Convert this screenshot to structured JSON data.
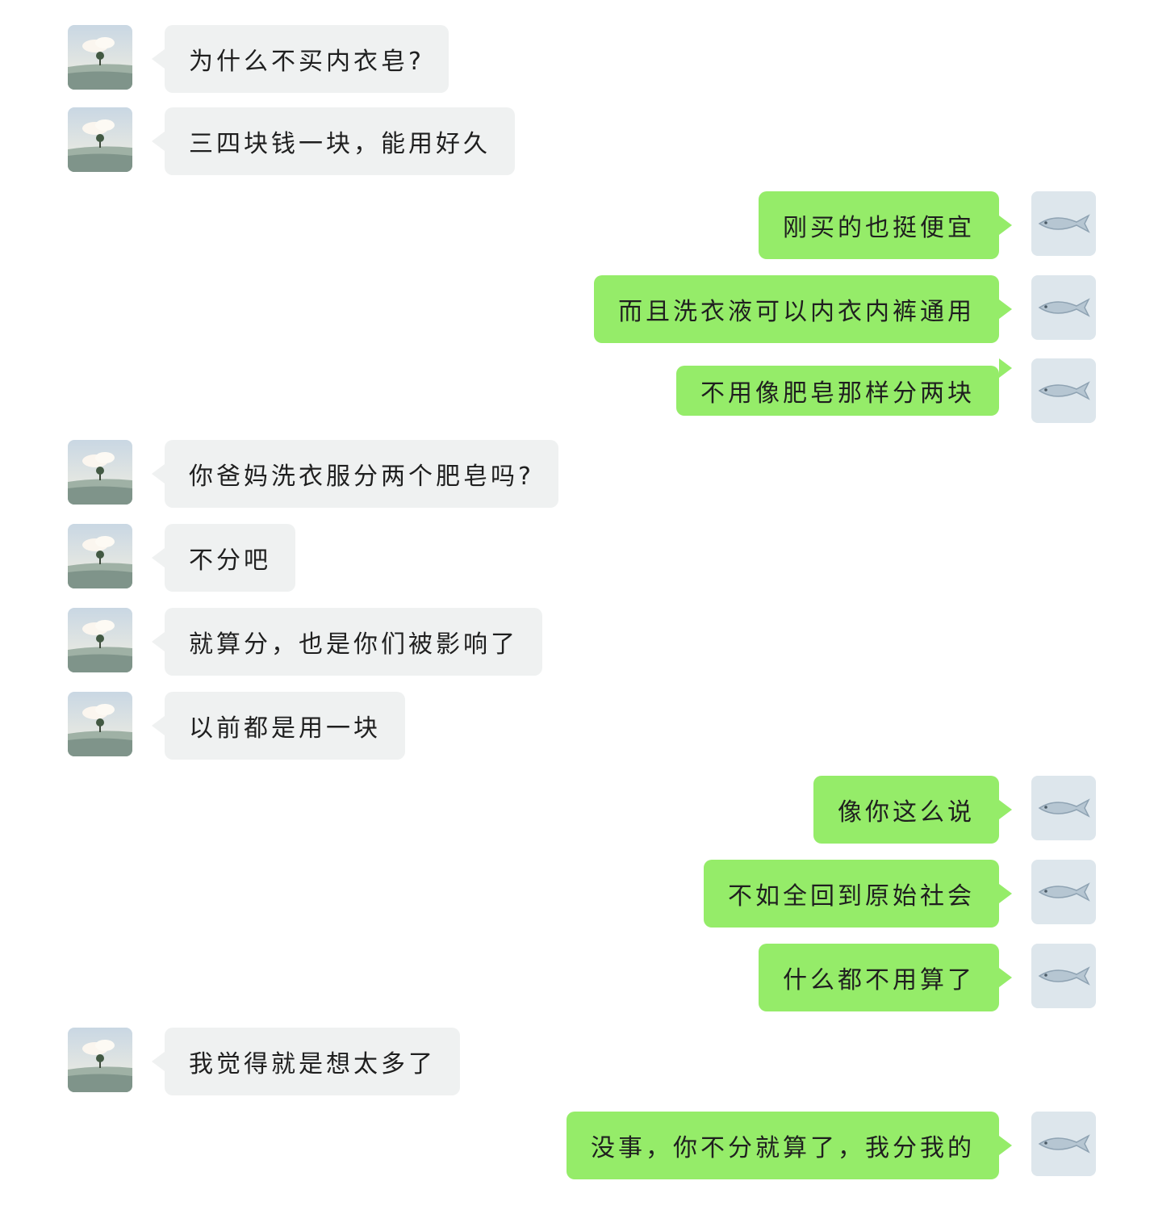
{
  "colors": {
    "incoming_bubble": "#eff1f1",
    "outgoing_bubble": "#95ec69",
    "text": "#1f1f1f"
  },
  "avatars": {
    "incoming": "tree-landscape-avatar-icon",
    "outgoing": "fish-avatar-icon"
  },
  "messages": [
    {
      "side": "in",
      "text": "为什么不买内衣皂?"
    },
    {
      "side": "in",
      "text": "三四块钱一块，能用好久"
    },
    {
      "side": "out",
      "text": "刚买的也挺便宜"
    },
    {
      "side": "out",
      "text": "而且洗衣液可以内衣内裤通用"
    },
    {
      "side": "out",
      "text": "不用像肥皂那样分两块"
    },
    {
      "side": "in",
      "text": "你爸妈洗衣服分两个肥皂吗?"
    },
    {
      "side": "in",
      "text": "不分吧"
    },
    {
      "side": "in",
      "text": "就算分，也是你们被影响了"
    },
    {
      "side": "in",
      "text": "以前都是用一块"
    },
    {
      "side": "out",
      "text": "像你这么说"
    },
    {
      "side": "out",
      "text": "不如全回到原始社会"
    },
    {
      "side": "out",
      "text": "什么都不用算了"
    },
    {
      "side": "in",
      "text": "我觉得就是想太多了"
    },
    {
      "side": "out",
      "text": "没事，你不分就算了，我分我的"
    }
  ]
}
